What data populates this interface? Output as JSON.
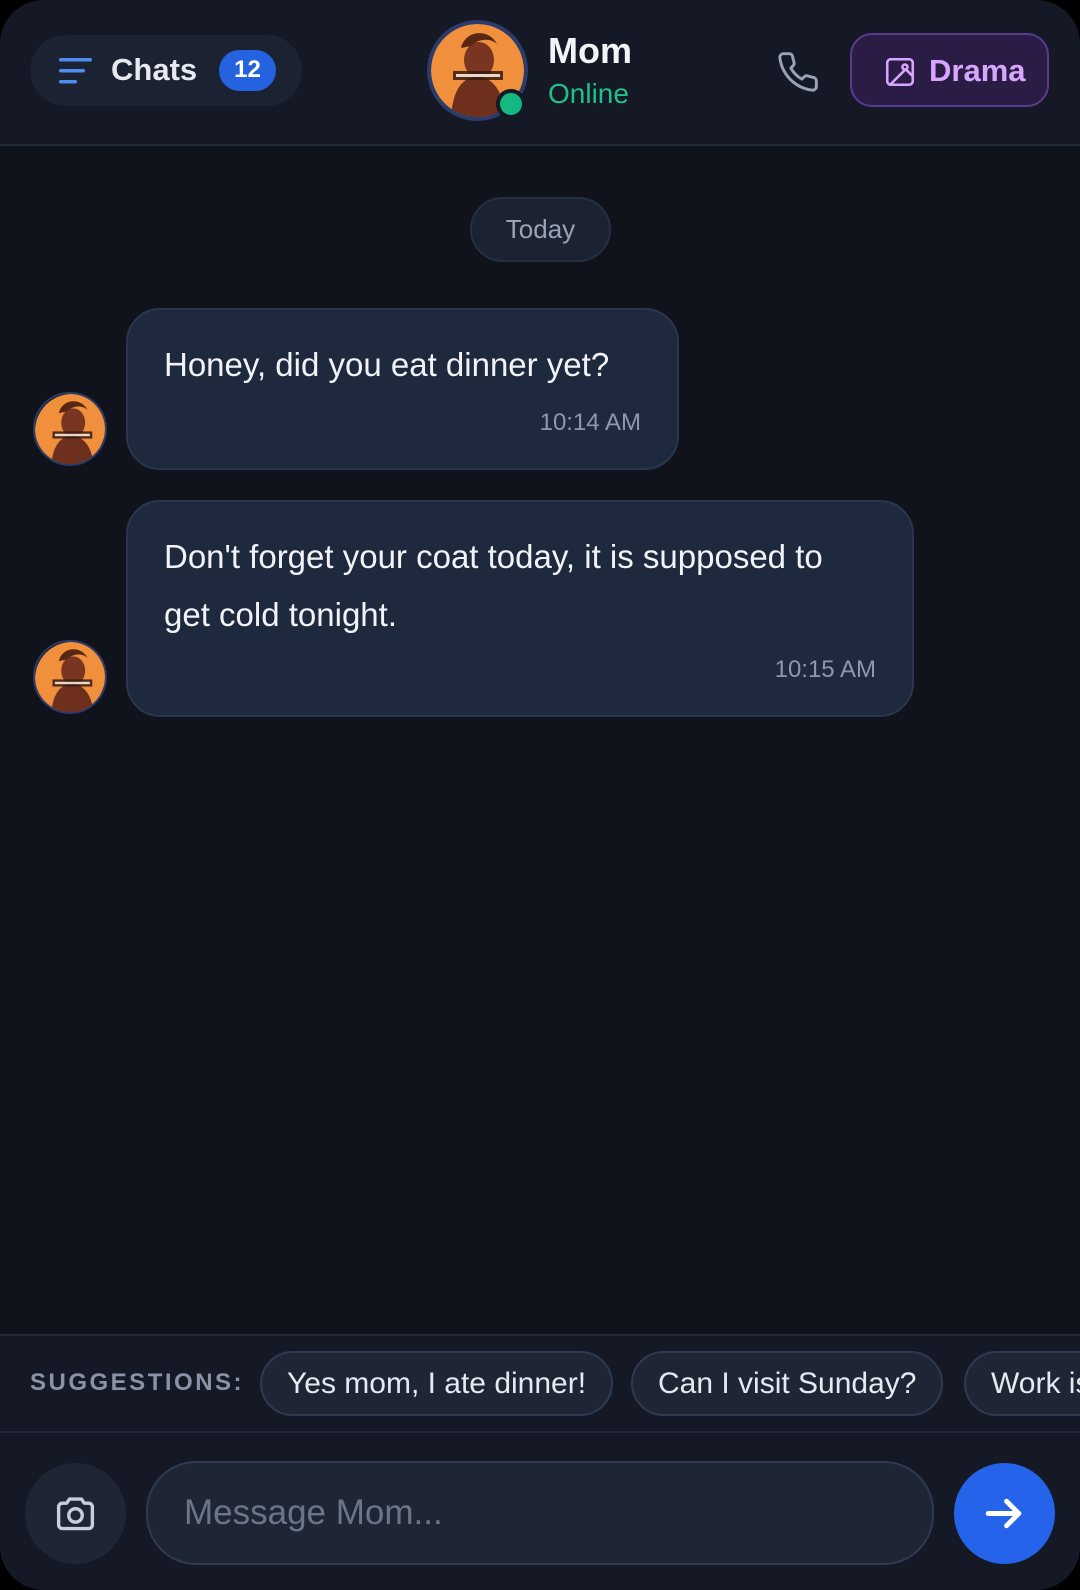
{
  "header": {
    "chats_label": "Chats",
    "unread_count": "12",
    "contact_name": "Mom",
    "contact_status": "Online",
    "drama_label": "Drama",
    "menu_icon": "menu-icon",
    "phone_icon": "phone-icon",
    "drama_icon": "image-icon"
  },
  "date_divider": "Today",
  "messages": [
    {
      "text": "Honey, did you eat dinner yet?",
      "time": "10:14 AM"
    },
    {
      "text_line1": "Don't forget your coat today, it is supposed to",
      "text_line2": "get cold tonight.",
      "time": "10:15 AM"
    }
  ],
  "suggestions": {
    "label": "SUGGESTIONS:",
    "items": [
      "Yes mom, I ate dinner!",
      "Can I visit Sunday?",
      "Work is"
    ]
  },
  "composer": {
    "placeholder": "Message Mom...",
    "camera_icon": "camera-icon",
    "send_icon": "arrow-right-icon"
  },
  "colors": {
    "background": "#10131c",
    "accent": "#2563eb",
    "online": "#1fc08a",
    "drama": "#d7a6ff"
  }
}
